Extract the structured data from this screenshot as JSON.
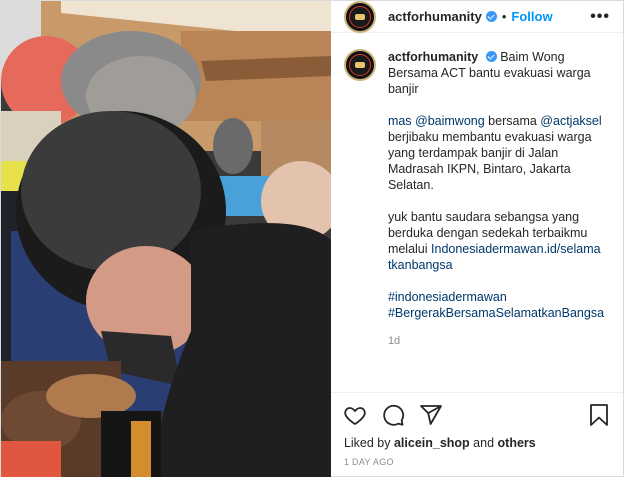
{
  "header": {
    "username": "actforhumanity",
    "separator": "•",
    "follow_label": "Follow",
    "more_label": "•••"
  },
  "caption": {
    "username": "actforhumanity",
    "title": "Baim Wong Bersama ACT bantu evakuasi warga banjir",
    "para1_mention1": "mas @baimwong",
    "para1_mid": " bersama ",
    "para1_mention2": "@actjaksel",
    "para1_rest": " berjibaku membantu evakuasi warga yang terdampak banjir di Jalan Madrasah IKPN, Bintaro, Jakarta Selatan.",
    "para2_text": "yuk bantu saudara sebangsa yang berduka dengan sedekah terbaikmu melalui ",
    "para2_link": "Indonesiadermawan.id/selamatkanbangsa",
    "hashtag1": "#indonesiadermawan",
    "hashtag2": "#BergerakBersamaSelamatkanBangsa",
    "age": "1d"
  },
  "actions": {
    "like_icon": "heart-icon",
    "comment_icon": "comment-icon",
    "share_icon": "share-icon",
    "save_icon": "bookmark-icon"
  },
  "likes": {
    "prefix": "Liked by ",
    "user": "alicein_shop",
    "middle": " and ",
    "others": "others"
  },
  "timestamp": "1 DAY AGO",
  "colors": {
    "accent": "#0095f6",
    "link": "#00376b",
    "verified": "#3897f0",
    "muted": "#8e8e8e"
  }
}
